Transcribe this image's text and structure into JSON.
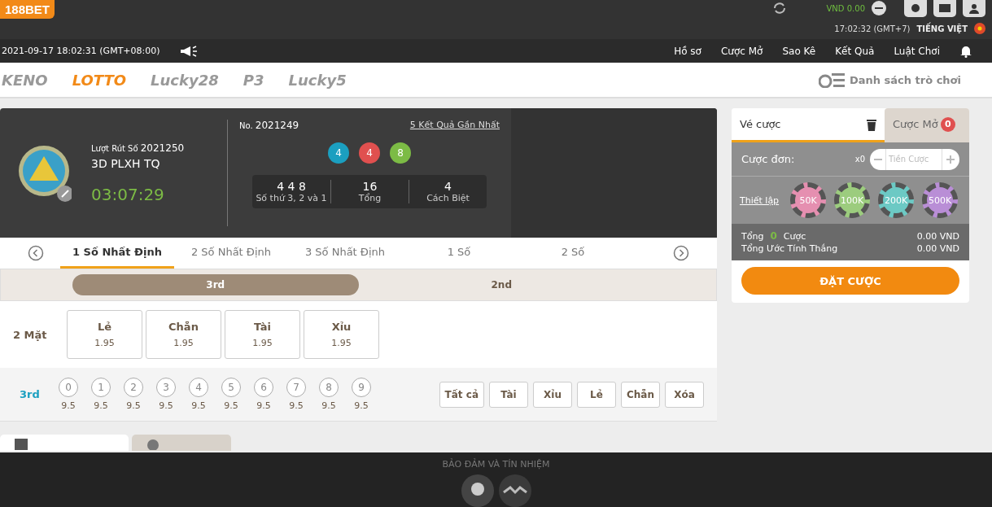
{
  "header": {
    "logo": "188BET",
    "balance": "VND 0.00",
    "time": "17:02:32 (GMT+7)",
    "language": "TIẾNG VIỆT"
  },
  "nav": {
    "datetime": "2021-09-17 18:02:31 (GMT+08:00)",
    "links": [
      "Hồ sơ",
      "Cược Mở",
      "Sao Kê",
      "Kết Quả",
      "Luật Chơi"
    ]
  },
  "games": [
    {
      "label": "KENO",
      "selected": false
    },
    {
      "label": "LOTTO",
      "selected": true
    },
    {
      "label": "Lucky28",
      "selected": false
    },
    {
      "label": "P3",
      "selected": false
    },
    {
      "label": "Lucky5",
      "selected": false
    }
  ],
  "game_list": "Danh sách trò chơi",
  "draw": {
    "round_label": "Lượt Rút Số",
    "round": "2021250",
    "name": "3D PLXH TQ",
    "countdown": "03:07:29",
    "prev_no_label": "No.",
    "prev_no": "2021249",
    "recent_link": "5 Kết Quả Gần Nhất",
    "balls": [
      {
        "value": "4",
        "color": "#1b9fc0"
      },
      {
        "value": "4",
        "color": "#e0504f"
      },
      {
        "value": "8",
        "color": "#7cbb45"
      }
    ],
    "stats": [
      {
        "value": "4 4 8",
        "label": "Số thứ 3, 2 và 1"
      },
      {
        "value": "16",
        "label": "Tổng"
      },
      {
        "value": "4",
        "label": "Cách Biệt"
      }
    ]
  },
  "bet_types": [
    {
      "label": "1 Số Nhất Định",
      "selected": true
    },
    {
      "label": "2 Số Nhất Định",
      "selected": false
    },
    {
      "label": "3 Số Nhất Định",
      "selected": false
    },
    {
      "label": "1 Số",
      "selected": false
    },
    {
      "label": "2 Số",
      "selected": false
    }
  ],
  "positions": [
    {
      "label": "3rd",
      "selected": true
    },
    {
      "label": "2nd",
      "selected": false
    }
  ],
  "two_sides": {
    "label": "2 Mặt",
    "options": [
      {
        "name": "Lẻ",
        "odds": "1.95"
      },
      {
        "name": "Chẵn",
        "odds": "1.95"
      },
      {
        "name": "Tài",
        "odds": "1.95"
      },
      {
        "name": "Xỉu",
        "odds": "1.95"
      }
    ]
  },
  "digits": {
    "label": "3rd",
    "items": [
      {
        "digit": "0",
        "odds": "9.5"
      },
      {
        "digit": "1",
        "odds": "9.5"
      },
      {
        "digit": "2",
        "odds": "9.5"
      },
      {
        "digit": "3",
        "odds": "9.5"
      },
      {
        "digit": "4",
        "odds": "9.5"
      },
      {
        "digit": "5",
        "odds": "9.5"
      },
      {
        "digit": "6",
        "odds": "9.5"
      },
      {
        "digit": "7",
        "odds": "9.5"
      },
      {
        "digit": "8",
        "odds": "9.5"
      },
      {
        "digit": "9",
        "odds": "9.5"
      }
    ],
    "quick": [
      "Tất cả",
      "Tài",
      "Xỉu",
      "Lẻ",
      "Chẵn",
      "Xóa"
    ]
  },
  "slip": {
    "tabs": [
      {
        "label": "Vé cược",
        "selected": true
      },
      {
        "label": "Cược Mở",
        "selected": false,
        "badge": "0"
      }
    ],
    "single_label": "Cược đơn:",
    "multiplier": "x0",
    "stake_placeholder": "Tiền Cược",
    "setup_link": "Thiết lập",
    "chips": [
      {
        "label": "50K",
        "color": "#e58fb0"
      },
      {
        "label": "100K",
        "color": "#9ccc7e"
      },
      {
        "label": "200K",
        "color": "#6cc9c4"
      },
      {
        "label": "500K",
        "color": "#b98ed6"
      }
    ],
    "total_label": "Tổng",
    "total_count": "0",
    "total_suffix": "Cược",
    "total_amount": "0.00 VND",
    "win_label": "Tổng Ước Tính Thắng",
    "win_amount": "0.00 VND",
    "place_button": "ĐẶT CƯỢC"
  },
  "footer": {
    "title": "BẢO ĐẢM VÀ TÍN NHIỆM"
  }
}
